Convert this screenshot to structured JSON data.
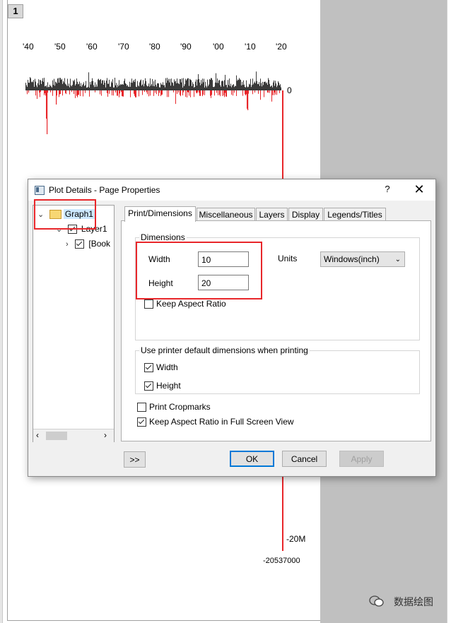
{
  "graph": {
    "layer_number": "1",
    "x_tick_labels": [
      "'40",
      "'50",
      "'60",
      "'70",
      "'80",
      "'90",
      "'00",
      "'10",
      "'20"
    ],
    "y_zero_label": "0",
    "y_bottom_label": "-20M",
    "y_min_label": "-20537000",
    "colors": {
      "positive": "#3a3a3a",
      "negative": "#e8262a",
      "axis": "#e8262a"
    }
  },
  "dialog": {
    "title": "Plot Details - Page Properties",
    "help": "?",
    "close": "✕",
    "tree": {
      "graph_label": "Graph1",
      "layer_label": "Layer1",
      "book_label": "[Book"
    },
    "tabs": [
      "Print/Dimensions",
      "Miscellaneous",
      "Layers",
      "Display",
      "Legends/Titles"
    ],
    "dimensions": {
      "group_label": "Dimensions",
      "width_label": "Width",
      "width_value": "10",
      "height_label": "Height",
      "height_value": "20",
      "units_label": "Units",
      "units_value": "Windows(inch)",
      "keep_aspect_label": "Keep Aspect Ratio"
    },
    "printer": {
      "group_label": "Use printer default dimensions when printing",
      "width_label": "Width",
      "height_label": "Height"
    },
    "print_cropmarks_label": "Print Cropmarks",
    "keep_aspect_fullscreen_label": "Keep Aspect Ratio in Full Screen View",
    "buttons": {
      "expand": ">>",
      "ok": "OK",
      "cancel": "Cancel",
      "apply": "Apply"
    }
  },
  "watermark": "数据绘图"
}
